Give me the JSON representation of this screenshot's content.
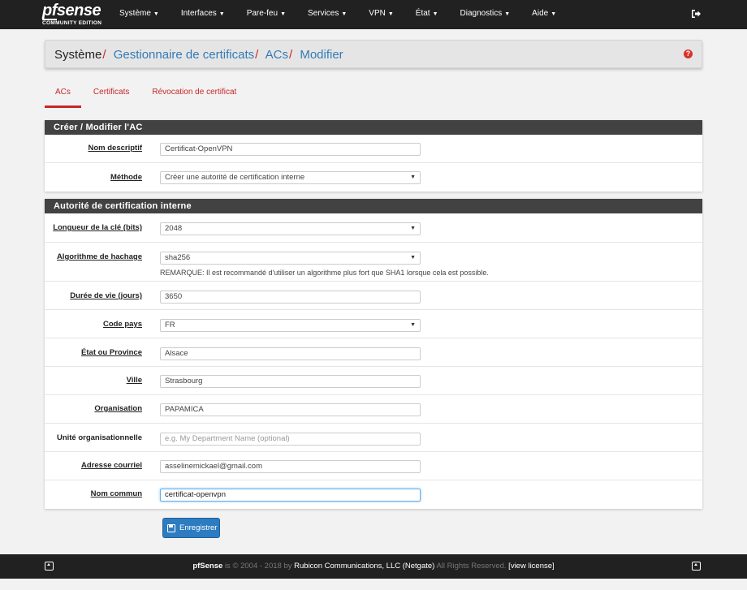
{
  "navbar": {
    "brand_pf": "pf",
    "brand_sense": "sense",
    "edition": "COMMUNITY EDITION",
    "menu": [
      "Système",
      "Interfaces",
      "Pare-feu",
      "Services",
      "VPN",
      "État",
      "Diagnostics",
      "Aide"
    ]
  },
  "breadcrumb": {
    "root": "Système",
    "items": [
      "Gestionnaire de certificats",
      "ACs",
      "Modifier"
    ],
    "separator": "/"
  },
  "tabs": [
    "ACs",
    "Certificats",
    "Révocation de certificat"
  ],
  "panel1": {
    "title": "Créer / Modifier l'AC",
    "rows": [
      {
        "label": "Nom descriptif",
        "value": "Certificat-OpenVPN"
      },
      {
        "label": "Méthode",
        "value": "Créer une autorité de certification interne"
      }
    ]
  },
  "panel2": {
    "title": "Autorité de certification interne",
    "rows": [
      {
        "label": "Longueur de la clé (bits)",
        "value": "2048"
      },
      {
        "label": "Algorithme de hachage",
        "value": "sha256",
        "note": "REMARQUE: Il est recommandé d'utiliser un algorithme plus fort que SHA1 lorsque cela est possible."
      },
      {
        "label": "Durée de vie (jours)",
        "value": "3650"
      },
      {
        "label": "Code pays",
        "value": "FR"
      },
      {
        "label": "État ou Province",
        "value": "Alsace"
      },
      {
        "label": "Ville",
        "value": "Strasbourg"
      },
      {
        "label": "Organisation",
        "value": "PAPAMICA"
      },
      {
        "label": "Unité organisationnelle",
        "value": "",
        "placeholder": "e.g. My Department Name (optional)"
      },
      {
        "label": "Adresse courriel",
        "value": "asselinemickael@gmail.com"
      },
      {
        "label": "Nom commun",
        "value": "certificat-openvpn"
      }
    ]
  },
  "save_label": "Enregistrer",
  "footer": {
    "product": "pfSense",
    "is": "is",
    "copyright": "© 2004 - 2018",
    "by": "by",
    "company": "Rubicon Communications, LLC (Netgate)",
    "rights": "All Rights Reserved.",
    "license": "view license"
  },
  "colors": {
    "accent": "#c62828",
    "link": "#337ab7",
    "navbar": "#212121",
    "button": "#2d7cc1"
  },
  "icons": {
    "logout": "sign-out-icon",
    "help": "question-circle-icon",
    "save": "save-icon",
    "footer": "up-arrow-square-icon"
  }
}
